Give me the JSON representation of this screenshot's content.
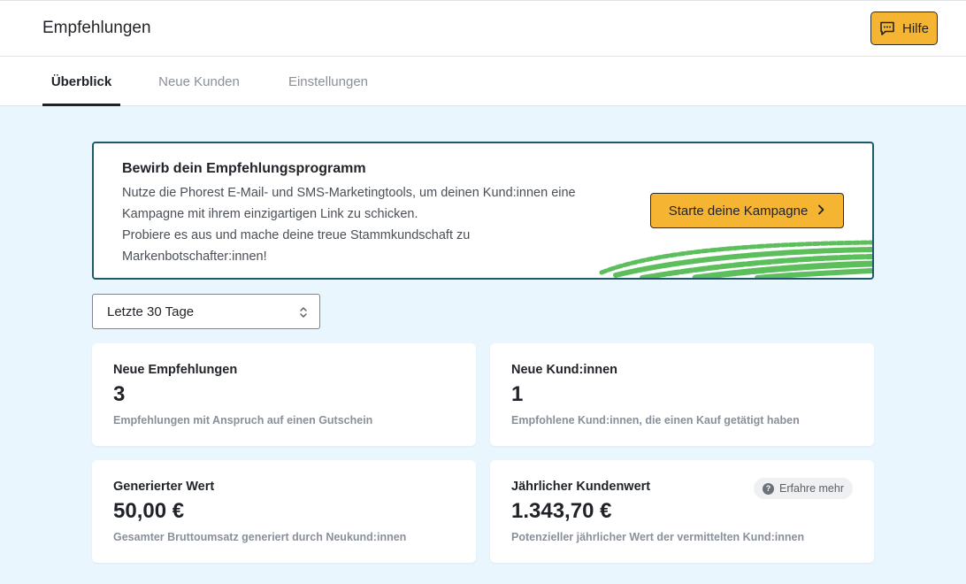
{
  "header": {
    "title": "Empfehlungen",
    "help_label": "Hilfe"
  },
  "tabs": [
    {
      "label": "Überblick",
      "active": true
    },
    {
      "label": "Neue Kunden",
      "active": false
    },
    {
      "label": "Einstellungen",
      "active": false
    }
  ],
  "promo": {
    "title": "Bewirb dein Empfehlungsprogramm",
    "lines": [
      "Nutze die Phorest E-Mail- und SMS-Marketingtools, um deinen Kund:innen eine",
      "Kampagne mit ihrem einzigartigen Link zu schicken.",
      "Probiere es aus und mache deine treue Stammkundschaft zu",
      "Markenbotschafter:innen!"
    ],
    "cta_label": "Starte deine Kampagne"
  },
  "filter": {
    "selected": "Letzte 30 Tage"
  },
  "stats": [
    {
      "title": "Neue Empfehlungen",
      "value": "3",
      "subtitle": "Empfehlungen mit Anspruch auf einen Gutschein"
    },
    {
      "title": "Neue Kund:innen",
      "value": "1",
      "subtitle": "Empfohlene Kund:innen, die einen Kauf getätigt haben"
    },
    {
      "title": "Generierter Wert",
      "value": "50,00 €",
      "subtitle": "Gesamter Bruttoumsatz generiert durch Neukund:innen"
    },
    {
      "title": "Jährlicher Kundenwert",
      "value": "1.343,70 €",
      "subtitle": "Potenzieller jährlicher Wert der vermittelten Kund:innen",
      "badge": "Erfahre mehr"
    }
  ],
  "colors": {
    "accent": "#f6b433",
    "background": "#eaf6fd",
    "promo_border": "#1f5a6b",
    "decoration_green": "#5cbf5c"
  }
}
